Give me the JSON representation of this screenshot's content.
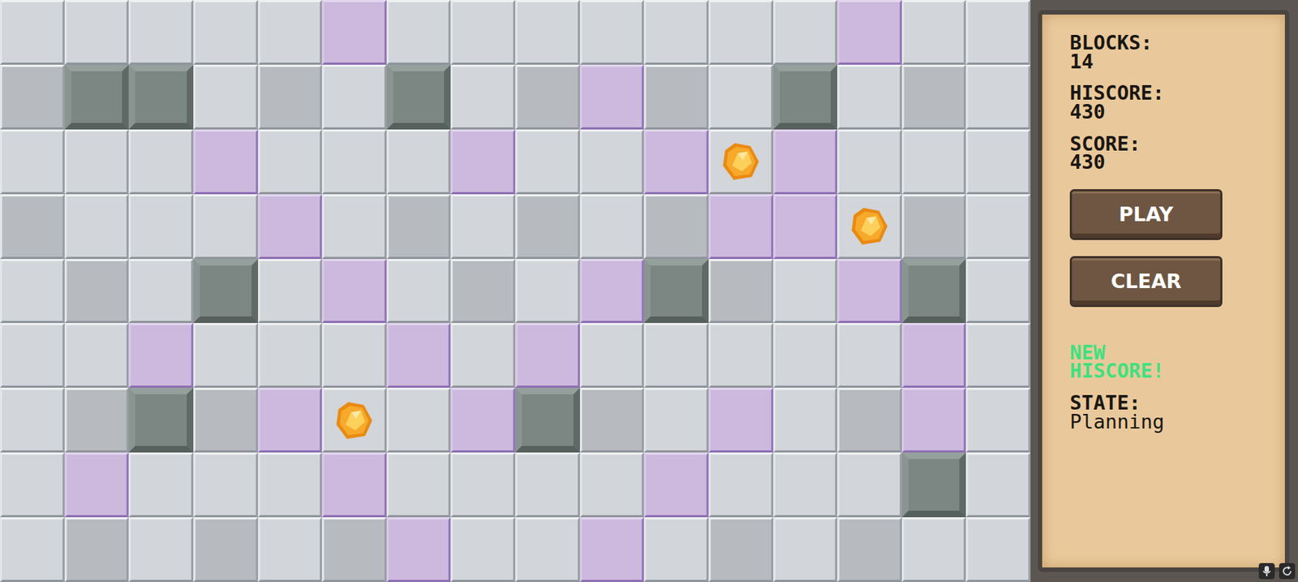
{
  "board": {
    "rows": [
      [
        "floor",
        "floor",
        "floor",
        "floor",
        "floor",
        "rune",
        "floor",
        "floor",
        "floor",
        "floor",
        "floor",
        "floor",
        "floor",
        "rune",
        "floor",
        "floor"
      ],
      [
        "shade",
        "block",
        "block",
        "floor",
        "shade",
        "floor",
        "block",
        "floor",
        "shade",
        "rune",
        "shade",
        "floor",
        "block",
        "floor",
        "shade",
        "floor"
      ],
      [
        "floor",
        "floor",
        "floor",
        "rune",
        "floor",
        "floor",
        "floor",
        "rune",
        "floor",
        "floor",
        "rune",
        "gem",
        "rune",
        "floor",
        "floor",
        "floor"
      ],
      [
        "shade",
        "floor",
        "floor",
        "floor",
        "rune",
        "floor",
        "shade",
        "floor",
        "shade",
        "floor",
        "shade",
        "rune",
        "rune",
        "gem",
        "shade",
        "floor"
      ],
      [
        "floor",
        "shade",
        "floor",
        "block",
        "floor",
        "rune",
        "floor",
        "shade",
        "floor",
        "rune",
        "block",
        "shade",
        "floor",
        "rune",
        "block",
        "floor"
      ],
      [
        "floor",
        "floor",
        "rune",
        "floor",
        "floor",
        "floor",
        "rune",
        "floor",
        "rune",
        "floor",
        "floor",
        "floor",
        "floor",
        "floor",
        "rune",
        "floor"
      ],
      [
        "floor",
        "shade",
        "block",
        "shade",
        "rune",
        "gem",
        "floor",
        "rune",
        "block",
        "shade",
        "floor",
        "rune",
        "floor",
        "shade",
        "rune",
        "floor"
      ],
      [
        "floor",
        "rune",
        "floor",
        "floor",
        "floor",
        "rune",
        "floor",
        "floor",
        "floor",
        "floor",
        "rune",
        "floor",
        "floor",
        "floor",
        "block",
        "floor"
      ],
      [
        "floor",
        "shade",
        "floor",
        "shade",
        "floor",
        "shade",
        "rune",
        "floor",
        "floor",
        "rune",
        "floor",
        "shade",
        "floor",
        "shade",
        "floor",
        "floor"
      ]
    ]
  },
  "panel": {
    "stats": [
      {
        "label": "BLOCKS:",
        "value": "14"
      },
      {
        "label": "HISCORE:",
        "value": "430"
      },
      {
        "label": "SCORE:",
        "value": "430"
      }
    ],
    "buttons": [
      "PLAY",
      "CLEAR"
    ],
    "notice": "NEW HISCORE!",
    "state": {
      "label": "STATE:",
      "value": "Planning"
    }
  }
}
